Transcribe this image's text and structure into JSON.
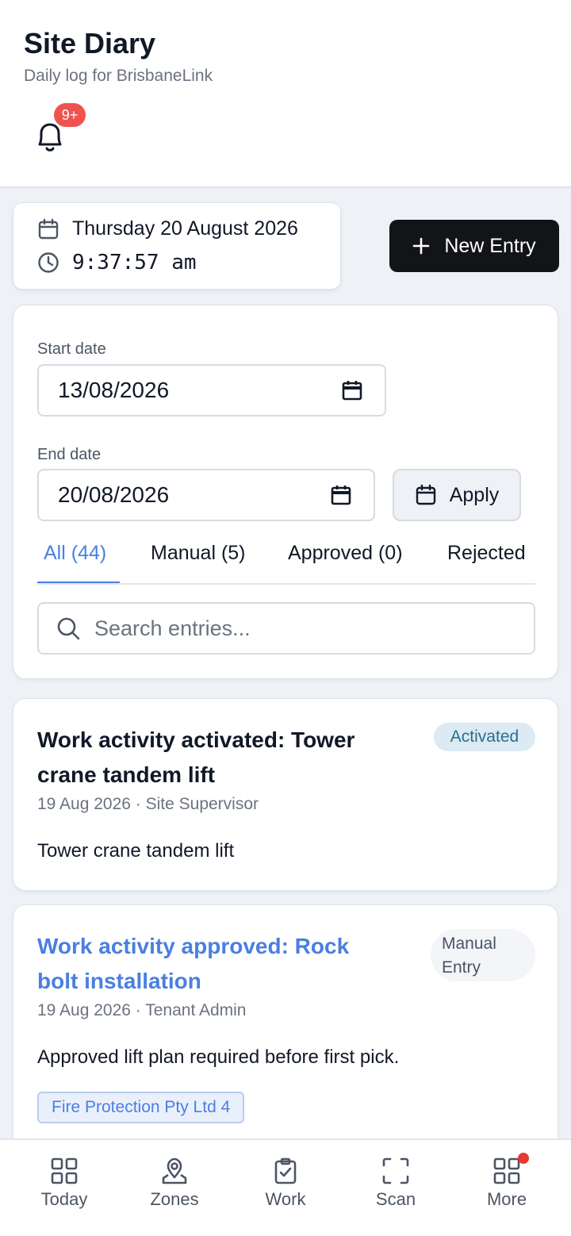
{
  "header": {
    "title": "Site Diary",
    "subtitle": "Daily log for BrisbaneLink",
    "notifications_badge": "9+"
  },
  "datetime": {
    "date": "Thursday 20 August 2026",
    "time": "9:37:57 am"
  },
  "new_entry_label": "New Entry",
  "filters": {
    "start_label": "Start date",
    "start_value": "13/08/2026",
    "end_label": "End date",
    "end_value": "20/08/2026",
    "apply_label": "Apply",
    "tabs": [
      {
        "label": "All (44)",
        "active": true
      },
      {
        "label": "Manual (5)",
        "active": false
      },
      {
        "label": "Approved (0)",
        "active": false
      },
      {
        "label": "Rejected",
        "active": false
      }
    ],
    "search_placeholder": "Search entries..."
  },
  "entries": [
    {
      "title": "Work activity activated: Tower crane tandem lift",
      "meta": "19 Aug 2026 · Site Supervisor",
      "body": "Tower crane tandem lift",
      "badge": "Activated"
    },
    {
      "title": "Work activity approved: Rock bolt installation",
      "meta": "19 Aug 2026 · Tenant Admin",
      "body": "Approved lift plan required before first pick.",
      "badge_line1": "Manual",
      "badge_line2": "Entry",
      "tag": "Fire Protection Pty Ltd 4"
    }
  ],
  "bottom_nav": [
    {
      "label": "Today",
      "icon": "grid-icon"
    },
    {
      "label": "Zones",
      "icon": "map-pin-icon"
    },
    {
      "label": "Work",
      "icon": "clipboard-check-icon"
    },
    {
      "label": "Scan",
      "icon": "scan-icon"
    },
    {
      "label": "More",
      "icon": "grid-icon"
    }
  ],
  "colors": {
    "accent": "#4a7fe0",
    "badge_red": "#ef5350",
    "primary_button": "#121417"
  }
}
